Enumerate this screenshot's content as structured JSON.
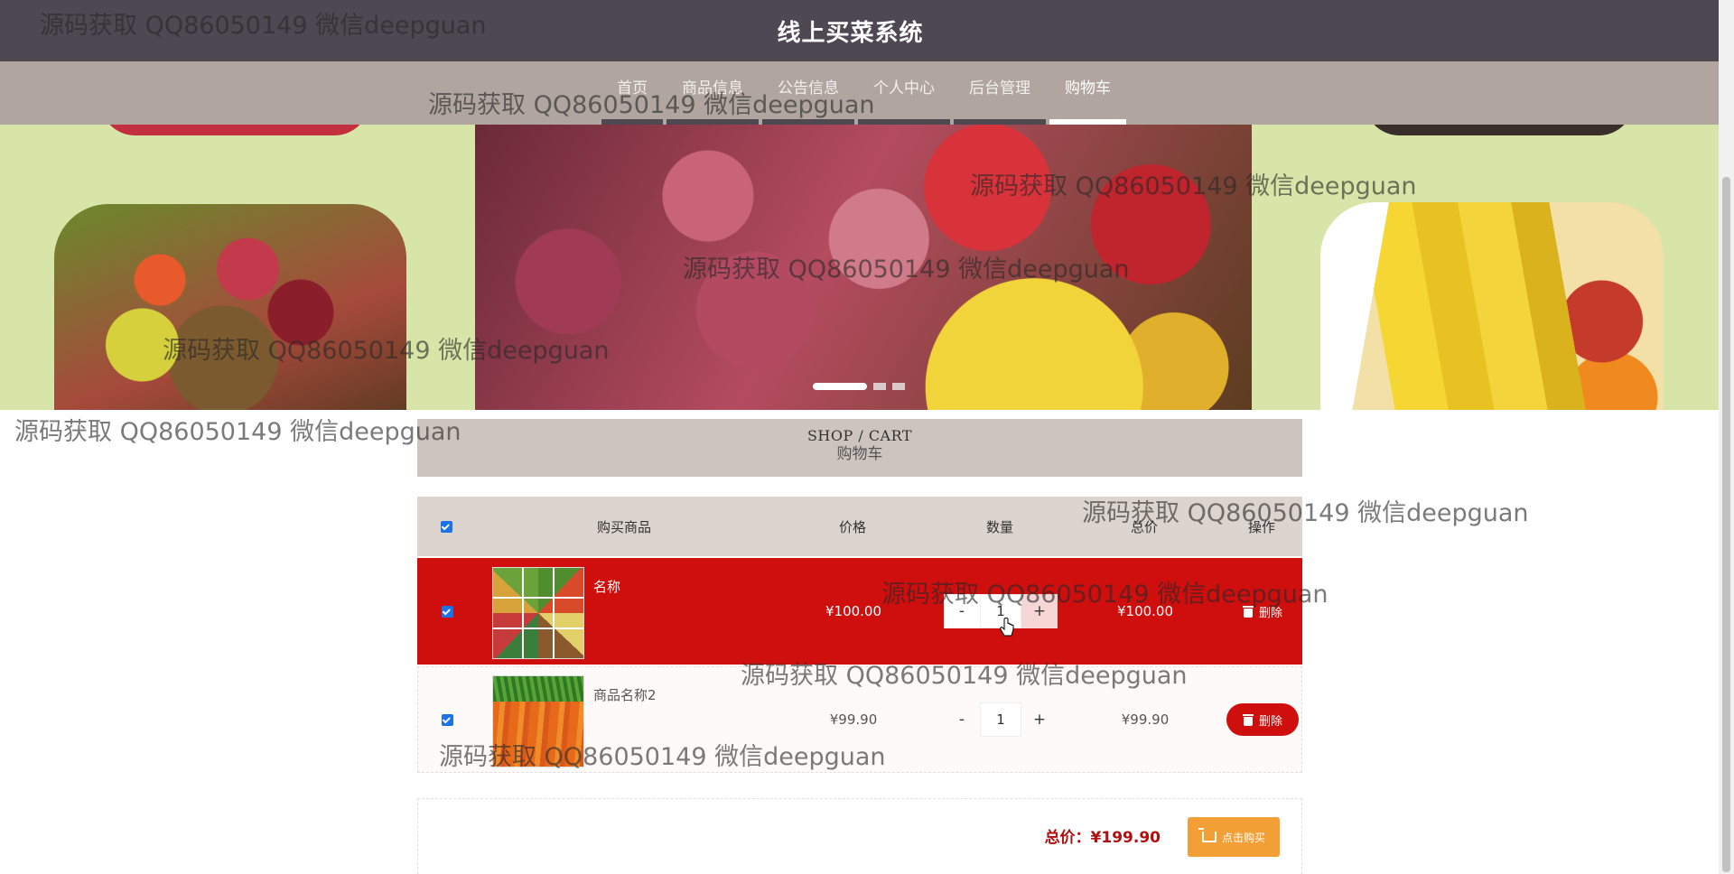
{
  "header": {
    "title": "线上买菜系统"
  },
  "nav": {
    "items": [
      "首页",
      "商品信息",
      "公告信息",
      "个人中心",
      "后台管理",
      "购物车"
    ],
    "active_index": 5
  },
  "banner": {
    "slide_count": 3,
    "active_slide": 1
  },
  "section": {
    "title_en": "SHOP / CART",
    "title_zh": "购物车"
  },
  "cart": {
    "columns": {
      "product": "购买商品",
      "price": "价格",
      "quantity": "数量",
      "total": "总价",
      "action": "操作"
    },
    "select_all_checked": true,
    "items": [
      {
        "name": "名称",
        "price": "¥100.00",
        "qty_minus": "-",
        "quantity": "1",
        "qty_plus": "+",
        "subtotal": "¥100.00",
        "delete_label": "删除",
        "checked": true,
        "thumbnail": "vegetable-collage"
      },
      {
        "name": "商品名称2",
        "price": "¥99.90",
        "qty_minus": "-",
        "quantity": "1",
        "qty_plus": "+",
        "subtotal": "¥99.90",
        "delete_label": "删除",
        "checked": true,
        "thumbnail": "carrots"
      }
    ],
    "total_label": "总价：¥199.90",
    "buy_button": "点击购买"
  },
  "watermark": "源码获取 QQ86050149 微信deepguan",
  "colors": {
    "topbar": "#4e4852",
    "navbar": "#b1a59f",
    "accent_red": "#cf0e0e",
    "buy_orange": "#f2a035"
  }
}
